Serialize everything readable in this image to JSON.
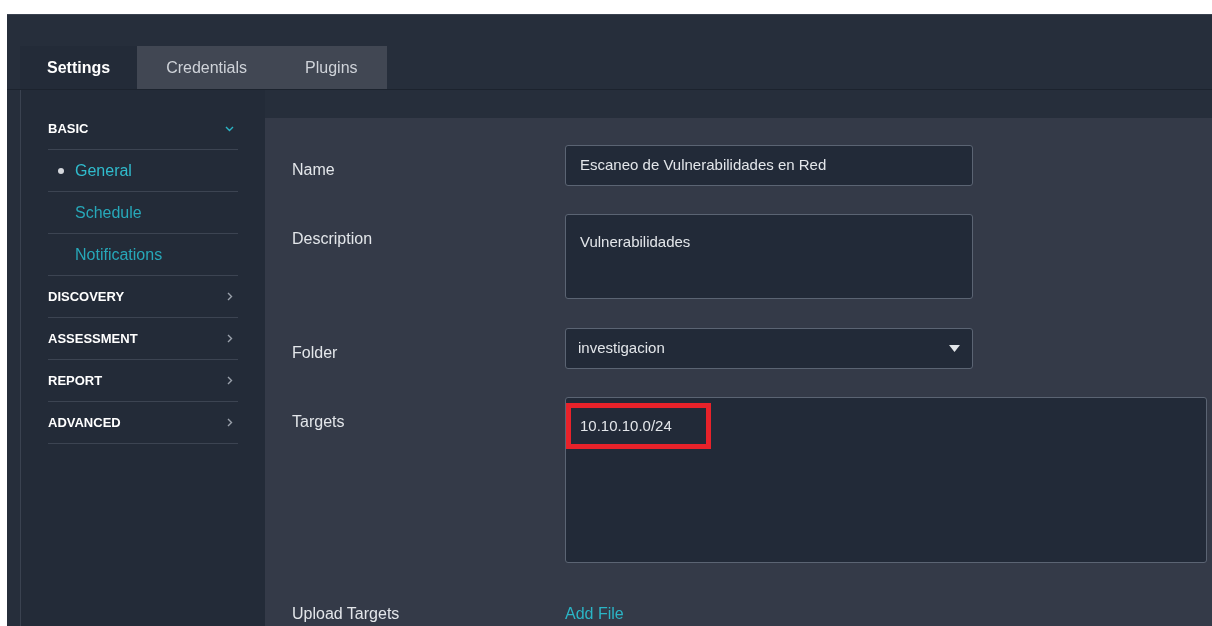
{
  "tabs": [
    {
      "label": "Settings",
      "selected": true
    },
    {
      "label": "Credentials",
      "selected": false
    },
    {
      "label": "Plugins",
      "selected": false
    }
  ],
  "sidebar": {
    "sections": [
      {
        "label": "BASIC",
        "expanded": true,
        "children": [
          {
            "label": "General",
            "selected": true
          },
          {
            "label": "Schedule",
            "selected": false
          },
          {
            "label": "Notifications",
            "selected": false
          }
        ]
      },
      {
        "label": "DISCOVERY",
        "expanded": false
      },
      {
        "label": "ASSESSMENT",
        "expanded": false
      },
      {
        "label": "REPORT",
        "expanded": false
      },
      {
        "label": "ADVANCED",
        "expanded": false
      }
    ]
  },
  "form": [
    {
      "kind": "text",
      "label": "Name",
      "value": "Escaneo de Vulnerabilidades en Red"
    },
    {
      "kind": "textarea",
      "label": "Description",
      "value": "Vulnerabilidades"
    },
    {
      "kind": "select",
      "label": "Folder",
      "value": "investigacion"
    },
    {
      "kind": "targets",
      "label": "Targets",
      "value": "10.10.10.0/24",
      "highlighted": true
    },
    {
      "kind": "file",
      "label": "Upload Targets",
      "value": "Add File"
    }
  ]
}
